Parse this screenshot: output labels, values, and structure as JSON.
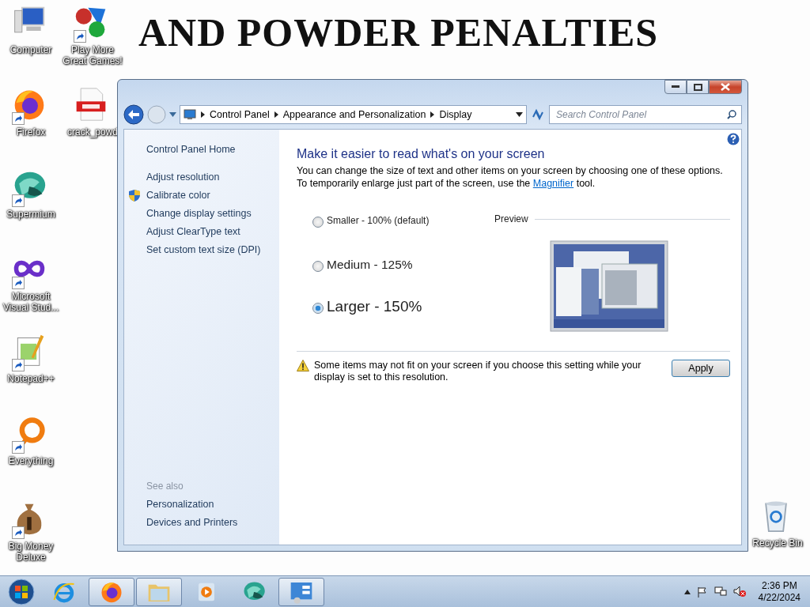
{
  "wallpaper": {
    "headline": "AND POWDER PENALTIES"
  },
  "desktop_icons": [
    {
      "label": "Computer",
      "kind": "computer",
      "shortcut": false
    },
    {
      "label": "Play More Great Games!",
      "kind": "games",
      "shortcut": true
    },
    {
      "label": "Firefox",
      "kind": "firefox",
      "shortcut": true
    },
    {
      "label": "crack_powd",
      "kind": "pdf",
      "shortcut": false
    },
    {
      "label": "Supermium",
      "kind": "supermium",
      "shortcut": true
    },
    {
      "label": "Microsoft Visual Stud...",
      "kind": "vs",
      "shortcut": true
    },
    {
      "label": "Notepad++",
      "kind": "notepad",
      "shortcut": true
    },
    {
      "label": "Everything",
      "kind": "everything",
      "shortcut": true
    },
    {
      "label": "Big Money Deluxe",
      "kind": "money",
      "shortcut": true
    },
    {
      "label": "Recycle Bin",
      "kind": "recycle",
      "shortcut": false
    }
  ],
  "window": {
    "breadcrumb": [
      "Control Panel",
      "Appearance and Personalization",
      "Display"
    ],
    "search": {
      "placeholder": "Search Control Panel"
    },
    "sidebar": {
      "home": "Control Panel Home",
      "tasks": [
        {
          "label": "Adjust resolution",
          "shield": false
        },
        {
          "label": "Calibrate color",
          "shield": true
        },
        {
          "label": "Change display settings",
          "shield": false
        },
        {
          "label": "Adjust ClearType text",
          "shield": false
        },
        {
          "label": "Set custom text size (DPI)",
          "shield": false
        }
      ],
      "see_also": {
        "title": "See also",
        "items": [
          "Personalization",
          "Devices and Printers"
        ]
      }
    },
    "content": {
      "heading": "Make it easier to read what's on your screen",
      "intro_before": "You can change the size of text and other items on your screen by choosing one of these options. To temporarily enlarge just part of the screen, use the",
      "intro_link": "Magnifier",
      "intro_after": "tool.",
      "options": [
        {
          "label": "Smaller - 100% (default)",
          "selected": false
        },
        {
          "label": "Medium - 125%",
          "selected": false
        },
        {
          "label": "Larger - 150%",
          "selected": true
        }
      ],
      "preview_label": "Preview",
      "warning": "Some items may not fit on your screen if you choose this setting while your display is set to this resolution.",
      "apply": "Apply"
    }
  },
  "taskbar": {
    "items": [
      {
        "kind": "ie",
        "open": false
      },
      {
        "kind": "firefox",
        "open": true
      },
      {
        "kind": "explorer",
        "open": true
      },
      {
        "kind": "media",
        "open": false
      },
      {
        "kind": "supermium",
        "open": false
      },
      {
        "kind": "controlpanel",
        "open": true
      }
    ],
    "time": "2:36 PM",
    "date": "4/22/2024"
  }
}
